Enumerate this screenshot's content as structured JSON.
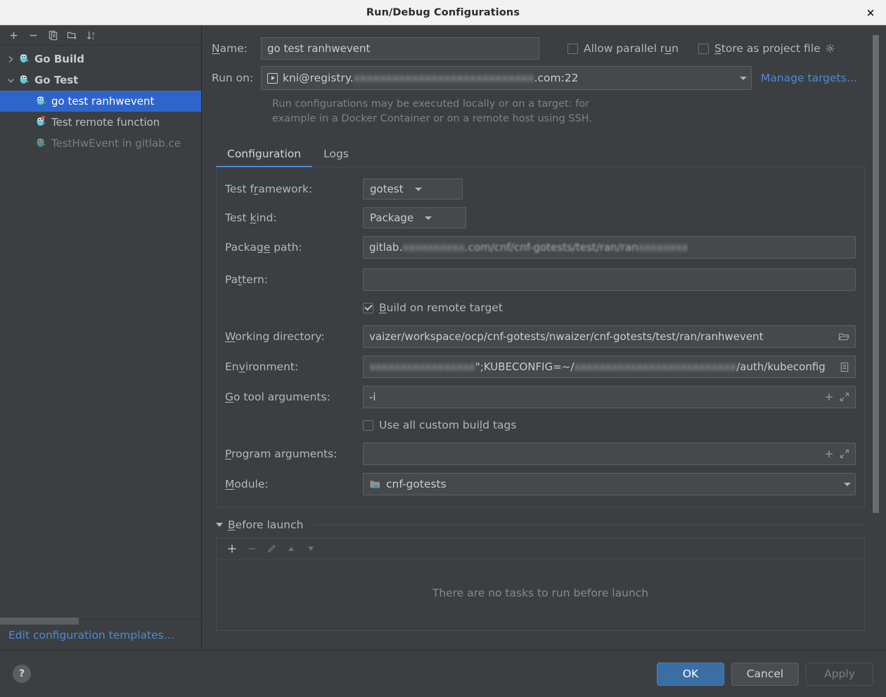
{
  "window": {
    "title": "Run/Debug Configurations",
    "close_label": "×"
  },
  "sidebar": {
    "toolbar": [
      {
        "name": "add-configuration-button",
        "icon": "plus-icon"
      },
      {
        "name": "remove-configuration-button",
        "icon": "minus-icon"
      },
      {
        "name": "copy-configuration-button",
        "icon": "copy-icon"
      },
      {
        "name": "new-folder-button",
        "icon": "folder-add-icon"
      },
      {
        "name": "sort-configurations-button",
        "icon": "sort-alphabetical-icon"
      }
    ],
    "tree": [
      {
        "label": "Go Build",
        "type": "group",
        "expanded": false,
        "twisty": "›"
      },
      {
        "label": "Go Test",
        "type": "group",
        "expanded": true,
        "twisty": "⌄"
      },
      {
        "label": "go test ranhwevent",
        "type": "child",
        "selected": true
      },
      {
        "label": "Test remote function",
        "type": "child",
        "selected": false
      },
      {
        "label": "TestHwEvent in gitlab.ce",
        "type": "child",
        "selected": false,
        "dim": true
      }
    ],
    "footer_link": "Edit configuration templates…"
  },
  "form": {
    "name_label": "Name:",
    "name_value": "go test ranhwevent",
    "allow_parallel_run": {
      "label": "Allow parallel run",
      "checked": false
    },
    "store_as_project_file": {
      "label": "Store as project file",
      "checked": false
    },
    "run_on_label": "Run on:",
    "run_on_prefix": "kni@registry.",
    "run_on_redacted": "xxxxxxxxxxxxxxxxxxxxxxxxxxxx",
    "run_on_suffix": ".com:22",
    "manage_targets_link": "Manage targets…",
    "hint_line1": "Run configurations may be executed locally or on a target: for",
    "hint_line2": "example in a Docker Container or on a remote host using SSH."
  },
  "tabs": [
    {
      "label": "Configuration",
      "active": true
    },
    {
      "label": "Logs",
      "active": false
    }
  ],
  "configuration": {
    "test_framework": {
      "label": "Test framework:",
      "value": "gotest"
    },
    "test_kind": {
      "label": "Test kind:",
      "value": "Package"
    },
    "package_path": {
      "label": "Package path:",
      "prefix": "gitlab.",
      "redacted1": "xxxxxxxxxx",
      "middle": ".com/cnf/cnf-gotests/test/ran/ran",
      "redacted2": "xxxxxxxx"
    },
    "pattern": {
      "label": "Pattern:",
      "value": ""
    },
    "build_on_remote_target": {
      "label": "Build on remote target",
      "checked": true
    },
    "working_directory": {
      "label": "Working directory:",
      "value": "vaizer/workspace/ocp/cnf-gotests/nwaizer/cnf-gotests/test/ran/ranhwevent",
      "icon": "folder-browse-icon"
    },
    "environment": {
      "label": "Environment:",
      "redacted_prefix": "xxxxxxxxxxxxxxxxx",
      "mid": "\";KUBECONFIG=~/",
      "redacted_mid": "xxxxxxxxxxxxxxxxxxxxxxxxxx",
      "suffix": "/auth/kubeconfig",
      "icon": "environment-variables-icon"
    },
    "go_tool_arguments": {
      "label": "Go tool arguments:",
      "value": "-i",
      "add_icon": "plus-icon",
      "expand_icon": "expand-icon"
    },
    "use_all_custom_build_tags": {
      "label": "Use all custom build tags",
      "checked": false
    },
    "program_arguments": {
      "label": "Program arguments:",
      "value": "",
      "add_icon": "plus-icon",
      "expand_icon": "expand-icon"
    },
    "module": {
      "label": "Module:",
      "value": "cnf-gotests",
      "icon": "module-icon"
    }
  },
  "before_launch": {
    "title": "Before launch",
    "empty_message": "There are no tasks to run before launch",
    "toolbar": [
      {
        "name": "add-task-button",
        "icon": "plus-icon",
        "enabled": true
      },
      {
        "name": "remove-task-button",
        "icon": "minus-icon",
        "enabled": false
      },
      {
        "name": "edit-task-button",
        "icon": "pencil-icon",
        "enabled": false
      },
      {
        "name": "move-task-up-button",
        "icon": "arrow-up-icon",
        "enabled": false
      },
      {
        "name": "move-task-down-button",
        "icon": "arrow-down-icon",
        "enabled": false
      }
    ]
  },
  "footer": {
    "help_label": "?",
    "ok_label": "OK",
    "cancel_label": "Cancel",
    "apply_label": "Apply"
  },
  "colors": {
    "accent": "#4a88d6",
    "selection": "#2f65ca",
    "link": "#4d89d6",
    "primary_button": "#3a6ea5",
    "background": "#3c3f41",
    "field": "#45494a"
  }
}
